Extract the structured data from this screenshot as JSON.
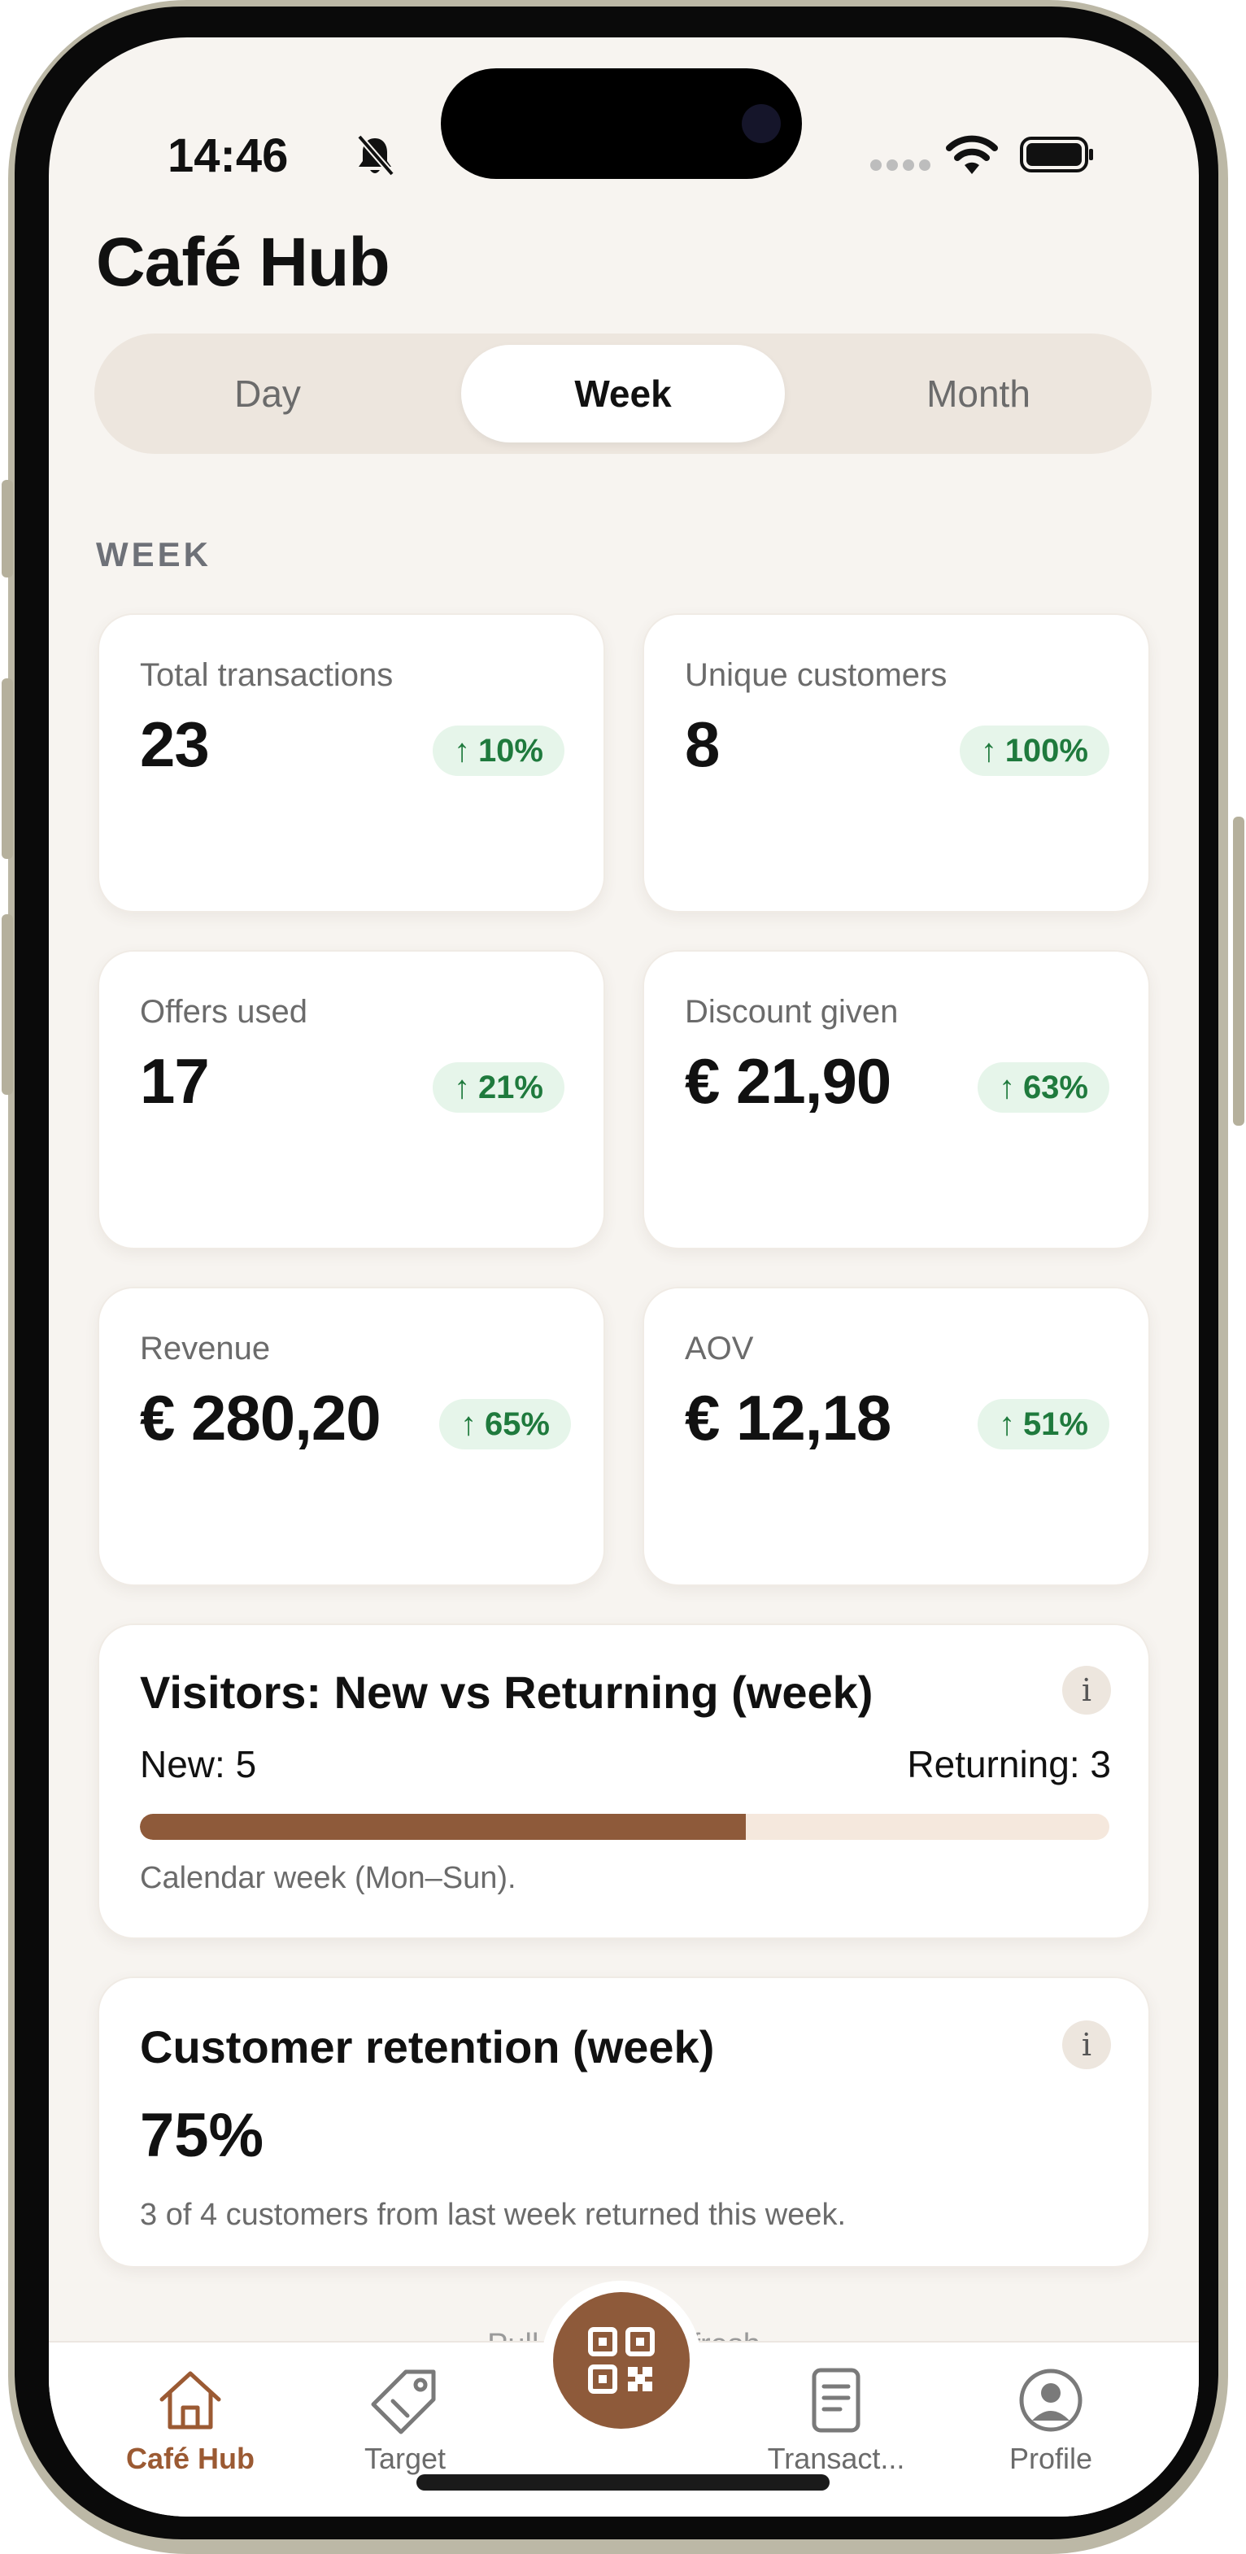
{
  "status_bar": {
    "time": "14:46"
  },
  "header": {
    "title": "Café Hub"
  },
  "period_tabs": {
    "day": "Day",
    "week": "Week",
    "month": "Month",
    "selected": "Week"
  },
  "section_label": "WEEK",
  "stats": {
    "total_transactions": {
      "label": "Total transactions",
      "value": "23",
      "change": "10%"
    },
    "unique_customers": {
      "label": "Unique customers",
      "value": "8",
      "change": "100%"
    },
    "offers_used": {
      "label": "Offers used",
      "value": "17",
      "change": "21%"
    },
    "discount_given": {
      "label": "Discount given",
      "value": "€ 21,90",
      "change": "63%"
    },
    "revenue": {
      "label": "Revenue",
      "value": "€ 280,20",
      "change": "65%"
    },
    "aov": {
      "label": "AOV",
      "value": "€ 12,18",
      "change": "51%"
    }
  },
  "visitors": {
    "title": "Visitors: New vs Returning (week)",
    "new_label": "New: 5",
    "returning_label": "Returning: 3",
    "new_count": 5,
    "returning_count": 3,
    "note": "Calendar week (Mon–Sun)."
  },
  "retention": {
    "title": "Customer retention (week)",
    "value": "75%",
    "note": "3 of 4 customers from last week returned this week."
  },
  "pull_to_refresh": "Pull down to refresh",
  "nav": {
    "home": "Café Hub",
    "target": "Target",
    "transactions": "Transact...",
    "profile": "Profile"
  },
  "colors": {
    "accent": "#8e5a3a",
    "positive": "#1f7a3d",
    "background": "#f7f4f0"
  },
  "icons": [
    "bell-slash-icon",
    "wifi-icon",
    "battery-icon",
    "info-icon",
    "arrow-up-icon",
    "home-icon",
    "tag-icon",
    "qr-code-icon",
    "document-icon",
    "profile-icon"
  ]
}
